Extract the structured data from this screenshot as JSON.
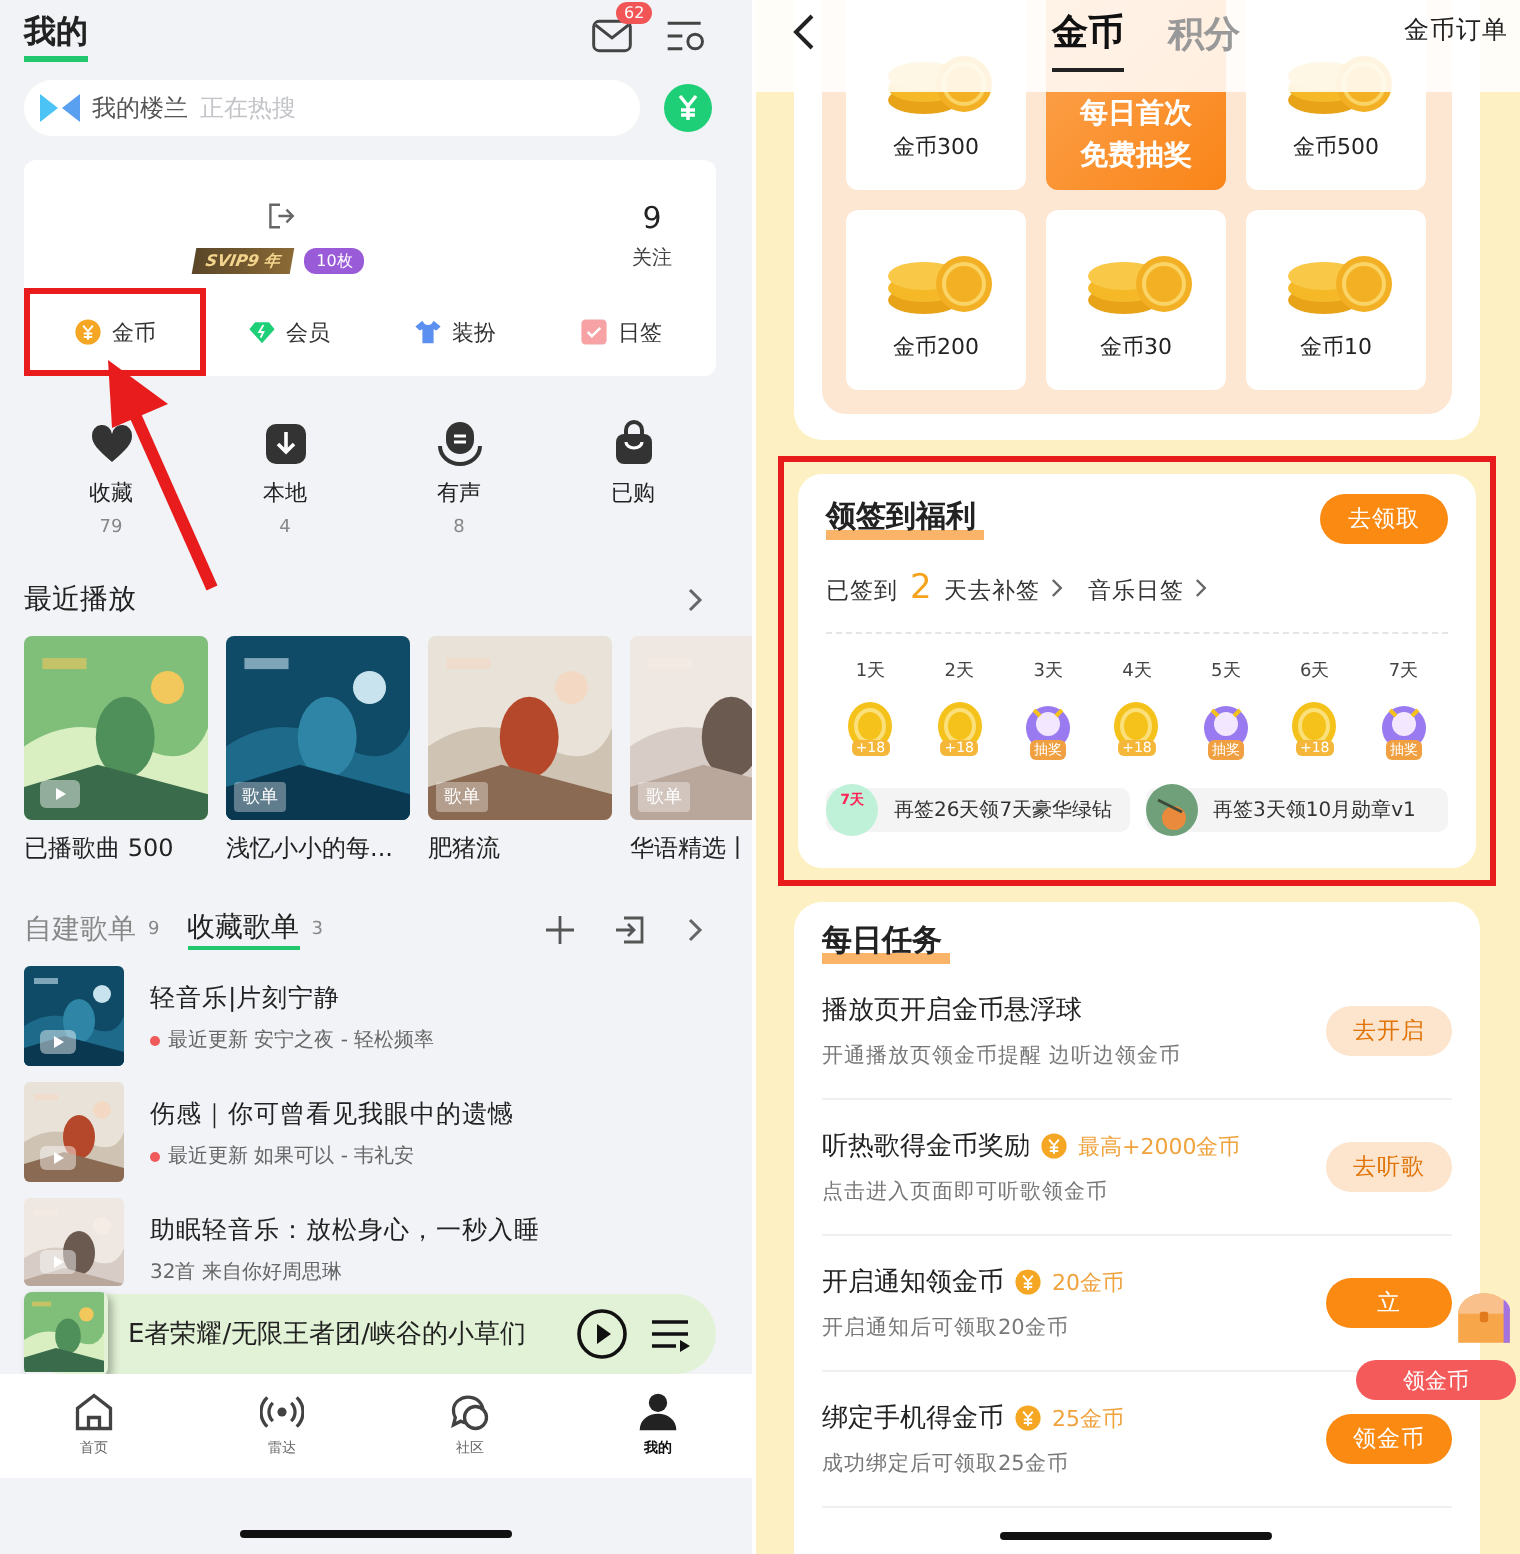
{
  "left": {
    "header": {
      "title": "我的",
      "mail_badge": "62"
    },
    "search": {
      "label": "我的楼兰",
      "placeholder": "正在热搜"
    },
    "profile": {
      "vip_badge": "SVIP9 年",
      "medal_badge": "10枚",
      "stat_value": "9",
      "stat_label": "关注"
    },
    "shortcuts": [
      {
        "kind": "coin",
        "label": "金币",
        "highlighted": true
      },
      {
        "kind": "vip",
        "label": "会员",
        "highlighted": false
      },
      {
        "kind": "dress",
        "label": "装扮",
        "highlighted": false
      },
      {
        "kind": "checkin",
        "label": "日签",
        "highlighted": false
      }
    ],
    "annotation_arrow": true,
    "library": [
      {
        "kind": "favorite",
        "label": "收藏",
        "count": "79"
      },
      {
        "kind": "local",
        "label": "本地",
        "count": "4"
      },
      {
        "kind": "audio",
        "label": "有声",
        "count": "8"
      },
      {
        "kind": "purchased",
        "label": "已购"
      }
    ],
    "recent": {
      "title": "最近播放",
      "items": [
        {
          "kind": "history",
          "caption": "已播歌曲 500"
        },
        {
          "kind": "playlist",
          "tag": "歌单",
          "caption": "浅忆小小的每..."
        },
        {
          "kind": "playlist",
          "tag": "歌单",
          "caption": "肥猪流"
        },
        {
          "kind": "playlist",
          "tag": "歌单",
          "caption": "华语精选丨"
        }
      ]
    },
    "playlist_tabs": [
      {
        "label": "自建歌单",
        "count": "9",
        "selected": false
      },
      {
        "label": "收藏歌单",
        "count": "3",
        "selected": true
      }
    ],
    "playlists": [
      {
        "title": "轻音乐|片刻宁静",
        "updated": true,
        "subtitle": "最近更新 安宁之夜 - 轻松频率"
      },
      {
        "title": "伤感｜你可曾看见我眼中的遗憾",
        "updated": true,
        "subtitle": "最近更新 如果可以 - 韦礼安"
      },
      {
        "title": "助眠轻音乐：放松身心，一秒入睡",
        "updated": false,
        "subtitle": "32首 来自你好周思琳"
      }
    ],
    "player": {
      "title": "E者荣耀/无限王者团/峡谷的小草们"
    },
    "nav": [
      {
        "kind": "home",
        "label": "首页",
        "selected": false
      },
      {
        "kind": "radar",
        "label": "雷达",
        "selected": false
      },
      {
        "kind": "community",
        "label": "社区",
        "selected": false
      },
      {
        "kind": "me",
        "label": "我的",
        "selected": true
      }
    ]
  },
  "right": {
    "header": {
      "tabs": [
        {
          "label": "金币",
          "selected": true
        },
        {
          "label": "积分",
          "selected": false
        }
      ],
      "orders_link": "金币订单"
    },
    "prizes": [
      {
        "kind": "coin",
        "label": "金币300"
      },
      {
        "kind": "lottery",
        "lines": [
          "每日首次",
          "免费抽奖"
        ]
      },
      {
        "kind": "coin",
        "label": "金币500"
      },
      {
        "kind": "coin",
        "label": "金币200"
      },
      {
        "kind": "coin",
        "label": "金币30"
      },
      {
        "kind": "coin",
        "label": "金币10"
      }
    ],
    "signin": {
      "highlighted": true,
      "title": "领签到福利",
      "button": "去领取",
      "prefix": "已签到",
      "days_count": "2",
      "makeup_link": "天去补签",
      "daily_link": "音乐日签",
      "days": [
        {
          "label": "1天",
          "kind": "coin",
          "reward": "+18"
        },
        {
          "label": "2天",
          "kind": "coin",
          "reward": "+18"
        },
        {
          "label": "3天",
          "kind": "lottery",
          "reward": "抽奖"
        },
        {
          "label": "4天",
          "kind": "coin",
          "reward": "+18"
        },
        {
          "label": "5天",
          "kind": "lottery",
          "reward": "抽奖"
        },
        {
          "label": "6天",
          "kind": "coin",
          "reward": "+18"
        },
        {
          "label": "7天",
          "kind": "lottery",
          "reward": "抽奖"
        }
      ],
      "promos": [
        {
          "kind": "diamond",
          "badge": "7天",
          "text": "再签26天领7天豪华绿钻"
        },
        {
          "kind": "medal",
          "text": "再签3天领10月勋章v1"
        }
      ]
    },
    "tasks": {
      "title": "每日任务",
      "items": [
        {
          "title": "播放页开启金币悬浮球",
          "desc": "开通播放页领金币提醒 边听边领金币",
          "button": "去开启",
          "kind": "light"
        },
        {
          "title": "听热歌得金币奖励",
          "reward": "最高+2000金币",
          "desc": "点击进入页面即可听歌领金币",
          "button": "去听歌",
          "kind": "light"
        },
        {
          "title": "开启通知领金币",
          "reward": "20金币",
          "desc": "开启通知后可领取20金币",
          "button": "立",
          "kind": "solid"
        },
        {
          "title": "绑定手机得金币",
          "reward": "25金币",
          "desc": "成功绑定后可领取25金币",
          "button": "领金币",
          "kind": "solid"
        }
      ]
    },
    "floating": {
      "label": "领金币"
    }
  }
}
